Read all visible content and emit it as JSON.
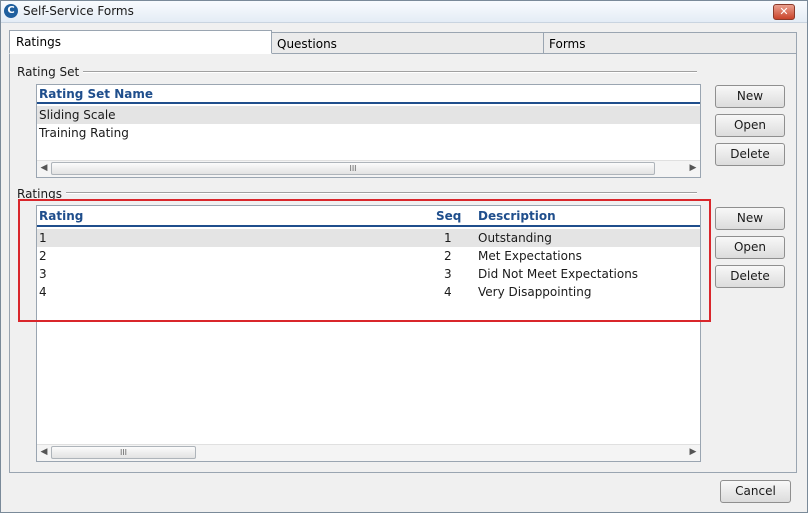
{
  "window": {
    "title": "Self-Service Forms",
    "close_glyph": "✕",
    "app_icon_glyph": "C"
  },
  "tabs": [
    {
      "label": "Ratings",
      "active": true
    },
    {
      "label": "Questions",
      "active": false
    },
    {
      "label": "Forms",
      "active": false
    }
  ],
  "rating_set": {
    "group_label": "Rating Set",
    "column_header": "Rating Set Name",
    "rows": [
      "Sliding Scale",
      "Training Rating"
    ],
    "selected_row": 0,
    "buttons": {
      "new": "New",
      "open": "Open",
      "delete": "Delete"
    },
    "scroll_thumb_grip": "III"
  },
  "ratings": {
    "group_label": "Ratings",
    "columns": {
      "rating": "Rating",
      "seq": "Seq",
      "description": "Description"
    },
    "rows": [
      {
        "rating": "1",
        "seq": "1",
        "description": "Outstanding"
      },
      {
        "rating": "2",
        "seq": "2",
        "description": "Met Expectations"
      },
      {
        "rating": "3",
        "seq": "3",
        "description": "Did Not Meet Expectations"
      },
      {
        "rating": "4",
        "seq": "4",
        "description": "Very Disappointing"
      }
    ],
    "selected_row": 0,
    "buttons": {
      "new": "New",
      "open": "Open",
      "delete": "Delete"
    },
    "scroll_thumb_grip": "III"
  },
  "footer": {
    "cancel": "Cancel"
  },
  "scroll_arrows": {
    "left": "◀",
    "right": "▶"
  },
  "colors": {
    "header_text": "#1f4e8c",
    "highlight_border": "#d9262b",
    "selected_row": "#e4e4e4"
  }
}
